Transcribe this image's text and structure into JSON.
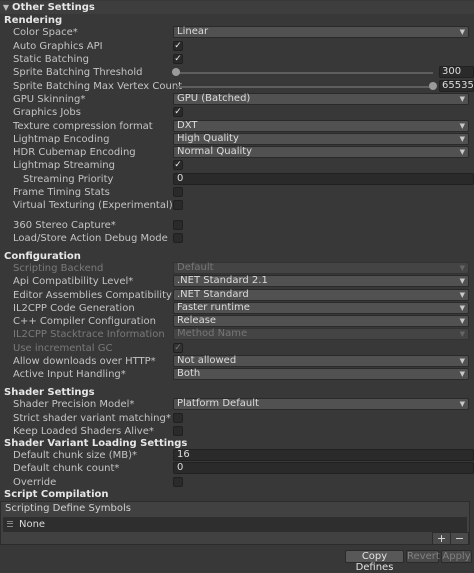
{
  "header": {
    "title": "Other Settings"
  },
  "rendering": {
    "title": "Rendering",
    "color_space": {
      "label": "Color Space*",
      "value": "Linear"
    },
    "auto_graphics_api": {
      "label": "Auto Graphics API",
      "checked": true
    },
    "static_batching": {
      "label": "Static Batching",
      "checked": true
    },
    "sprite_batching_threshold": {
      "label": "Sprite Batching Threshold",
      "value": "300",
      "fraction": 0
    },
    "sprite_batching_max_vertex": {
      "label": "Sprite Batching Max Vertex Count",
      "value": "65535",
      "fraction": 1
    },
    "gpu_skinning": {
      "label": "GPU Skinning*",
      "value": "GPU (Batched)"
    },
    "graphics_jobs": {
      "label": "Graphics Jobs",
      "checked": true
    },
    "texture_compression": {
      "label": "Texture compression format",
      "value": "DXT"
    },
    "lightmap_encoding": {
      "label": "Lightmap Encoding",
      "value": "High Quality"
    },
    "hdr_cubemap_encoding": {
      "label": "HDR Cubemap Encoding",
      "value": "Normal Quality"
    },
    "lightmap_streaming": {
      "label": "Lightmap Streaming",
      "checked": true
    },
    "streaming_priority": {
      "label": "Streaming Priority",
      "value": "0"
    },
    "frame_timing_stats": {
      "label": "Frame Timing Stats",
      "checked": false
    },
    "virtual_texturing": {
      "label": "Virtual Texturing (Experimental)*",
      "checked": false
    },
    "stereo_capture": {
      "label": "360 Stereo Capture*",
      "checked": false
    },
    "load_store_debug": {
      "label": "Load/Store Action Debug Mode",
      "checked": false
    }
  },
  "configuration": {
    "title": "Configuration",
    "scripting_backend": {
      "label": "Scripting Backend",
      "value": "Default"
    },
    "api_compat": {
      "label": "Api Compatibility Level*",
      "value": ".NET Standard 2.1"
    },
    "editor_assemblies_compat": {
      "label": "Editor Assemblies Compatibility Level*",
      "value": ".NET Standard"
    },
    "il2cpp_codegen": {
      "label": "IL2CPP Code Generation",
      "value": "Faster runtime"
    },
    "cpp_compiler_config": {
      "label": "C++ Compiler Configuration",
      "value": "Release"
    },
    "il2cpp_stacktrace": {
      "label": "IL2CPP Stacktrace Information",
      "value": "Method Name"
    },
    "incremental_gc": {
      "label": "Use incremental GC",
      "checked": true
    },
    "allow_http": {
      "label": "Allow downloads over HTTP*",
      "value": "Not allowed"
    },
    "active_input": {
      "label": "Active Input Handling*",
      "value": "Both"
    }
  },
  "shader": {
    "title": "Shader Settings",
    "precision_model": {
      "label": "Shader Precision Model*",
      "value": "Platform Default"
    },
    "strict_variant": {
      "label": "Strict shader variant matching*",
      "checked": false
    },
    "keep_loaded_alive": {
      "label": "Keep Loaded Shaders Alive*",
      "checked": false
    }
  },
  "variant_loading": {
    "title": "Shader Variant Loading Settings",
    "default_chunk_size": {
      "label": "Default chunk size (MB)*",
      "value": "16"
    },
    "default_chunk_count": {
      "label": "Default chunk count*",
      "value": "0"
    },
    "override": {
      "label": "Override",
      "checked": false
    }
  },
  "script_compilation": {
    "title": "Script Compilation",
    "define_symbols_header": "Scripting Define Symbols",
    "define_symbols_value": "None",
    "add_label": "+",
    "remove_label": "−"
  },
  "actions": {
    "copy": "Copy Defines",
    "revert": "Revert",
    "apply": "Apply"
  }
}
